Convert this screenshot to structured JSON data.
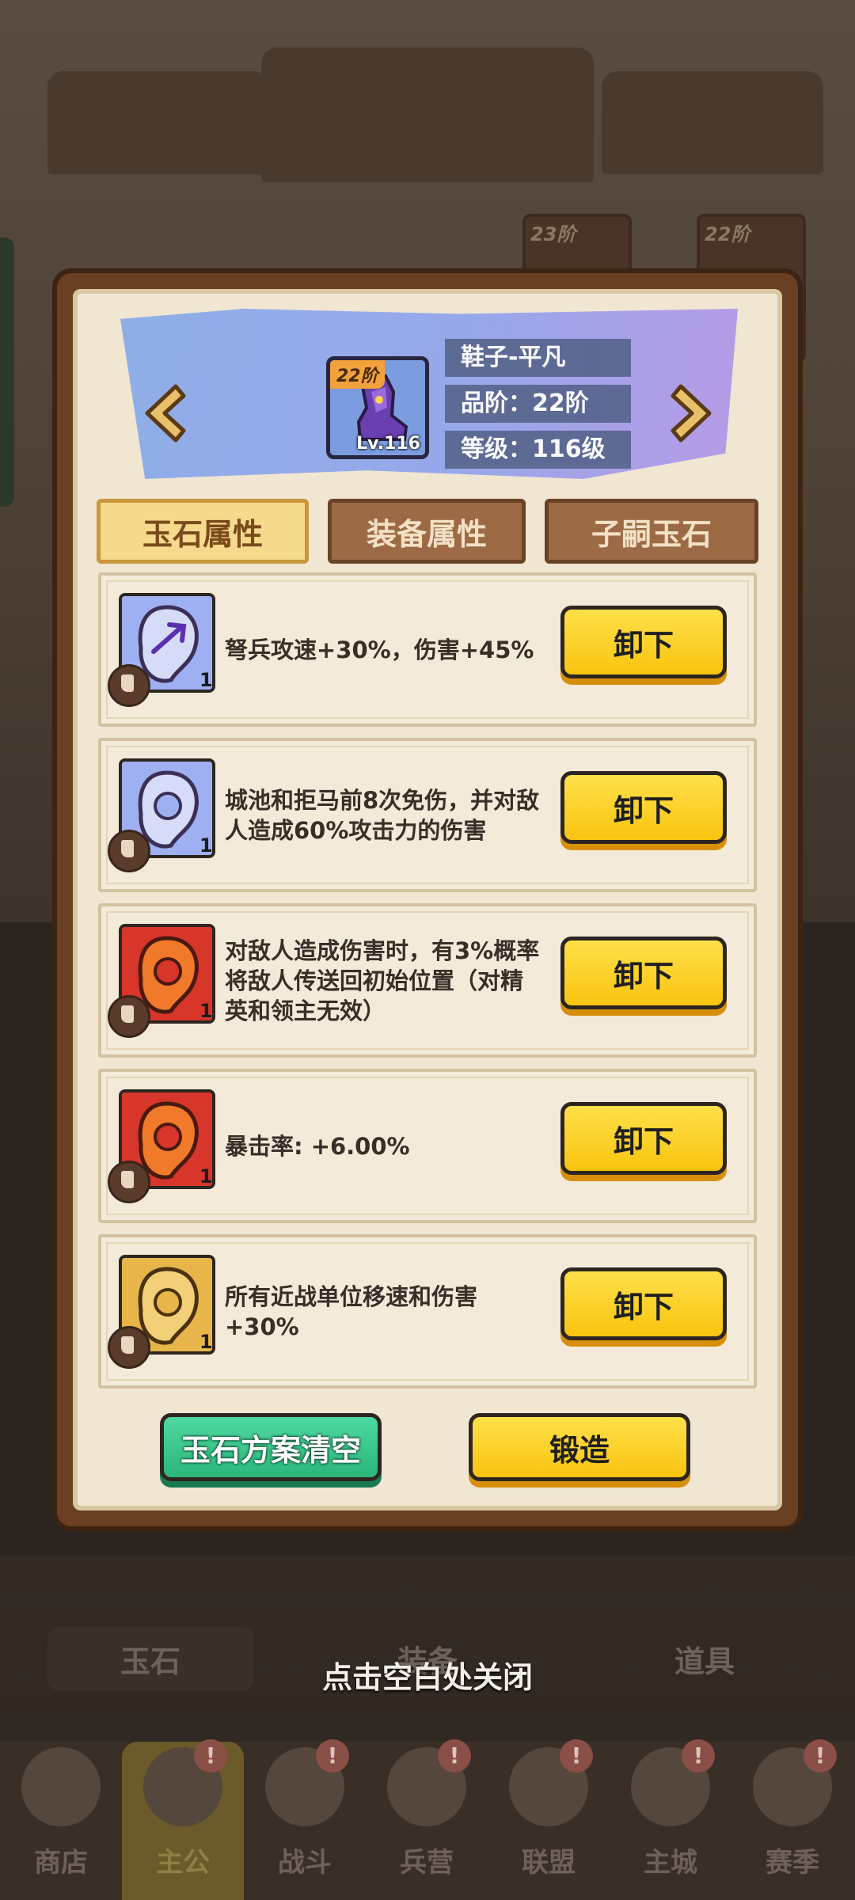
{
  "background": {
    "tabs": [
      "玉石",
      "装备",
      "道具"
    ],
    "nav": [
      {
        "label": "商店",
        "badge": ""
      },
      {
        "label": "主公",
        "badge": "!"
      },
      {
        "label": "战斗",
        "badge": "!"
      },
      {
        "label": "兵营",
        "badge": "!"
      },
      {
        "label": "联盟",
        "badge": "!"
      },
      {
        "label": "主城",
        "badge": "!"
      },
      {
        "label": "赛季",
        "badge": "!"
      }
    ],
    "card_tiers": [
      "23阶",
      "22阶"
    ]
  },
  "header": {
    "portrait_tier": "22阶",
    "portrait_level": "Lv.116",
    "item_name": "鞋子-平凡",
    "quality_line": "品阶：22阶",
    "level_line": "等级：116级"
  },
  "tabs": [
    {
      "label": "玉石属性",
      "active": true
    },
    {
      "label": "装备属性",
      "active": false
    },
    {
      "label": "子嗣玉石",
      "active": false
    }
  ],
  "jades": [
    {
      "color": "blue",
      "icon": "crossbow-jade-icon",
      "count": "1",
      "description": "弩兵攻速+30%，伤害+45%",
      "button": "卸下"
    },
    {
      "color": "blue",
      "icon": "blue-jade-icon",
      "count": "1",
      "description": "城池和拒马前8次免伤，并对敌人造成60%攻击力的伤害",
      "button": "卸下"
    },
    {
      "color": "red",
      "icon": "red-jade-icon",
      "count": "1",
      "description": "对敌人造成伤害时，有3%概率将敌人传送回初始位置（对精英和领主无效）",
      "button": "卸下"
    },
    {
      "color": "red",
      "icon": "red-jade-icon",
      "count": "1",
      "description": "暴击率: +6.00%",
      "button": "卸下"
    },
    {
      "color": "gold",
      "icon": "gold-jade-icon",
      "count": "1",
      "description": "所有近战单位移速和伤害+30%",
      "button": "卸下"
    }
  ],
  "actions": {
    "clear_label": "玉石方案清空",
    "forge_label": "锻造"
  },
  "close_hint": "点击空白处关闭",
  "colors": {
    "blue_jade": "#9fb0f2",
    "red_jade": "#d8352b",
    "gold_jade": "#e7b54a",
    "button_yellow": "#f8c40e",
    "button_green": "#2cb679"
  }
}
